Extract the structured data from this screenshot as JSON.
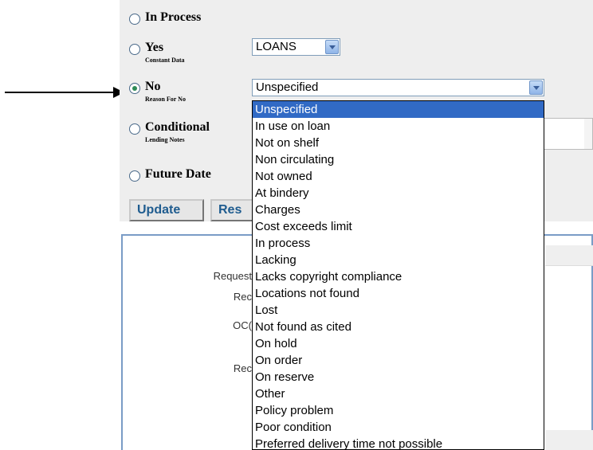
{
  "options": {
    "in_process": {
      "label": "In Process"
    },
    "yes": {
      "label": "Yes",
      "sublabel": "Constant Data",
      "select_value": "LOANS"
    },
    "no": {
      "label": "No",
      "sublabel": "Reason For No",
      "select_value": "Unspecified"
    },
    "conditional": {
      "label": "Conditional",
      "sublabel": "Lending Notes"
    },
    "future_date": {
      "label": "Future Date"
    }
  },
  "buttons": {
    "update": "Update",
    "reset": "Res"
  },
  "lower_fields": [
    "Request",
    "Rec",
    "OC(",
    "Rec"
  ],
  "dropdown_items": [
    "Unspecified",
    "In use on loan",
    "Not on shelf",
    "Non circulating",
    "Not owned",
    "At bindery",
    "Charges",
    "Cost exceeds limit",
    "In process",
    "Lacking",
    "Lacks copyright compliance",
    "Locations not found",
    "Lost",
    "Not found as cited",
    "On hold",
    "On order",
    "On reserve",
    "Other",
    "Policy problem",
    "Poor condition",
    "Preferred delivery time not possible"
  ],
  "selected_dropdown_index": 0,
  "colors": {
    "selection": "#316ac5",
    "button_text": "#1f5c8f",
    "panel": "#eeeeee",
    "radio_checked": "#2e8b57"
  }
}
